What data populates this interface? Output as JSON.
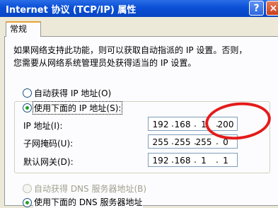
{
  "window": {
    "title": "Internet 协议 (TCP/IP) 属性",
    "help_label": "?",
    "close_label": "×"
  },
  "tab": {
    "label": "常规"
  },
  "description": {
    "line1": "如果网络支持此功能，则可以获取自动指派的 IP 设置。否则，",
    "line2": "您需要从网络系统管理员处获得适当的 IP 设置。"
  },
  "ip_mode": {
    "auto_label": "自动获得 IP 地址(O)",
    "manual_label": "使用下面的 IP 地址(S):",
    "selected": "manual"
  },
  "fields": {
    "ip": {
      "label": "IP 地址(I):",
      "octets": [
        "192",
        "168",
        "1",
        "200"
      ]
    },
    "subnet": {
      "label": "子网掩码(U):",
      "octets": [
        "255",
        "255",
        "255",
        "0"
      ]
    },
    "gateway": {
      "label": "默认网关(D):",
      "octets": [
        "192",
        "168",
        "1",
        "1"
      ]
    }
  },
  "dns_mode": {
    "auto_label": "自动获得 DNS 服务器地址(B)",
    "manual_label": "使用下面的 DNS 服务器地址"
  },
  "colors": {
    "titlebar": "#0a4fd6",
    "selected_radio": "#21a121",
    "annotation_circle": "#e41b1b"
  }
}
